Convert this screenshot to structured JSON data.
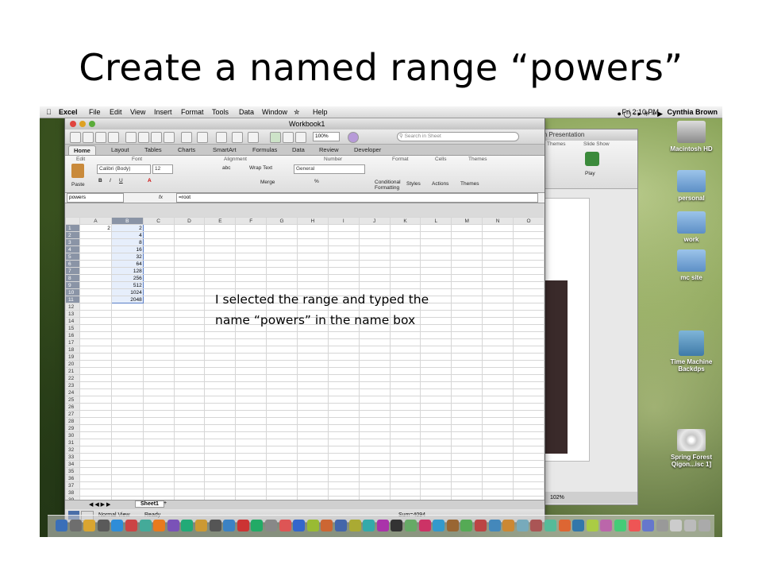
{
  "slide": {
    "title": "Create a named range “powers”",
    "note": "I selected the range and typed the name “powers” in the name box"
  },
  "menubar": {
    "app": "Excel",
    "items": [
      "File",
      "Edit",
      "View",
      "Insert",
      "Format",
      "Tools",
      "Data",
      "Window",
      "Help"
    ],
    "clock": "Fri 2:10 PM",
    "user": "Cynthia Brown"
  },
  "desktop": {
    "icons": [
      "Macintosh HD",
      "personal",
      "work",
      "mc site",
      "Time Machine Backdps",
      "Spring Forest Qigon...isc 1]"
    ]
  },
  "powerpoint": {
    "title": "is in Presentation",
    "groups": [
      "Themes",
      "Slide Show"
    ],
    "play_label": "Play",
    "zoom": "102%"
  },
  "excel": {
    "window_title": "Workbook1",
    "search_placeholder": "Search in Sheet",
    "zoom": "100%",
    "tabs": [
      "Home",
      "Layout",
      "Tables",
      "Charts",
      "SmartArt",
      "Formulas",
      "Data",
      "Review",
      "Developer"
    ],
    "ribbon": {
      "groups": [
        "Edit",
        "Font",
        "Alignment",
        "Number",
        "Format",
        "Cells",
        "Themes"
      ],
      "paste": "Paste",
      "font_name": "Calibri (Body)",
      "font_size": "12",
      "wrap_text": "Wrap Text",
      "merge": "Merge",
      "number_format": "General",
      "conditional_formatting": "Conditional Formatting",
      "styles": "Styles",
      "actions": "Actions",
      "themes": "Themes",
      "fill": "abc"
    },
    "name_box": "powers",
    "formula": "=root",
    "columns": [
      "A",
      "B",
      "C",
      "D",
      "E",
      "F",
      "G",
      "H",
      "I",
      "J",
      "K",
      "L",
      "M",
      "N",
      "O"
    ],
    "rows": [
      "1",
      "2",
      "3",
      "4",
      "5",
      "6",
      "7",
      "8",
      "9",
      "10",
      "11",
      "12",
      "13",
      "14",
      "15",
      "16",
      "17",
      "18",
      "19",
      "20",
      "21",
      "22",
      "23",
      "24",
      "25",
      "26",
      "27",
      "28",
      "29",
      "30",
      "31",
      "32",
      "33",
      "34",
      "35",
      "36",
      "37",
      "38",
      "39",
      "40"
    ],
    "cell_A1": "2",
    "col_b_values": [
      "2",
      "4",
      "8",
      "16",
      "32",
      "64",
      "128",
      "256",
      "512",
      "1024",
      "2048"
    ],
    "sheet_tab": "Sheet1",
    "view_mode": "Normal View",
    "status": "Ready",
    "sum": "Sum=4094"
  }
}
